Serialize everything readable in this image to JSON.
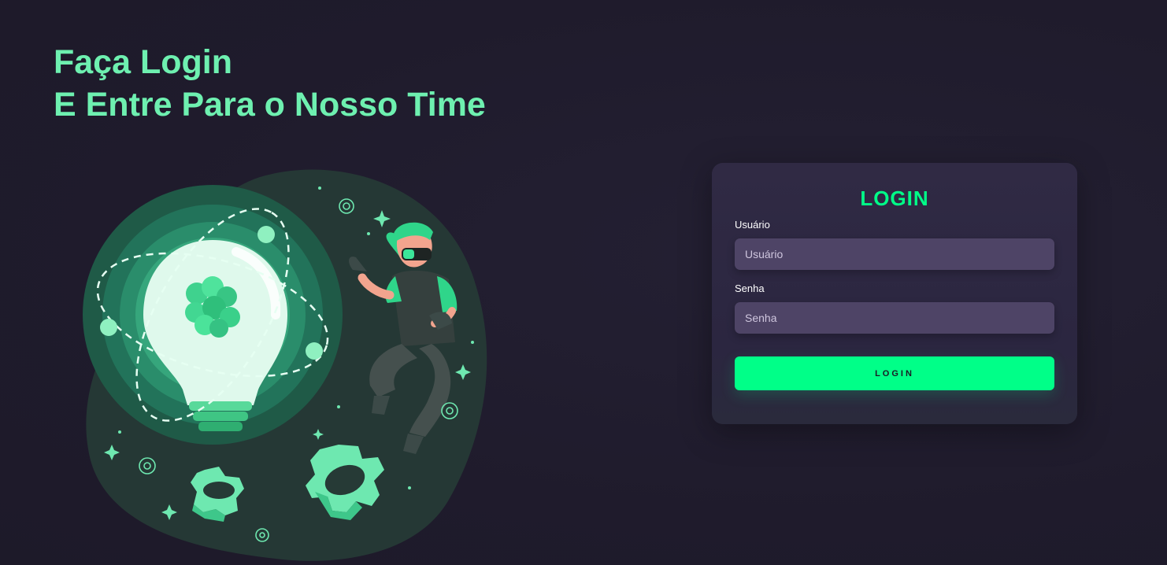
{
  "hero": {
    "line1": "Faça Login",
    "line2": "E Entre Para o Nosso Time"
  },
  "login_card": {
    "title": "LOGIN",
    "username": {
      "label": "Usuário",
      "placeholder": "Usuário",
      "value": ""
    },
    "password": {
      "label": "Senha",
      "placeholder": "Senha",
      "value": ""
    },
    "submit_label": "LOGIN"
  },
  "colors": {
    "background": "#1f1b2c",
    "accent": "#00ff88",
    "heading": "#6ef0b0",
    "card": "#2e2842",
    "input": "#4e4466"
  },
  "illustration": {
    "icons": [
      "light-bulb-icon",
      "atom-icon",
      "vr-person-icon",
      "gear-icon",
      "sparkle-icon"
    ]
  }
}
